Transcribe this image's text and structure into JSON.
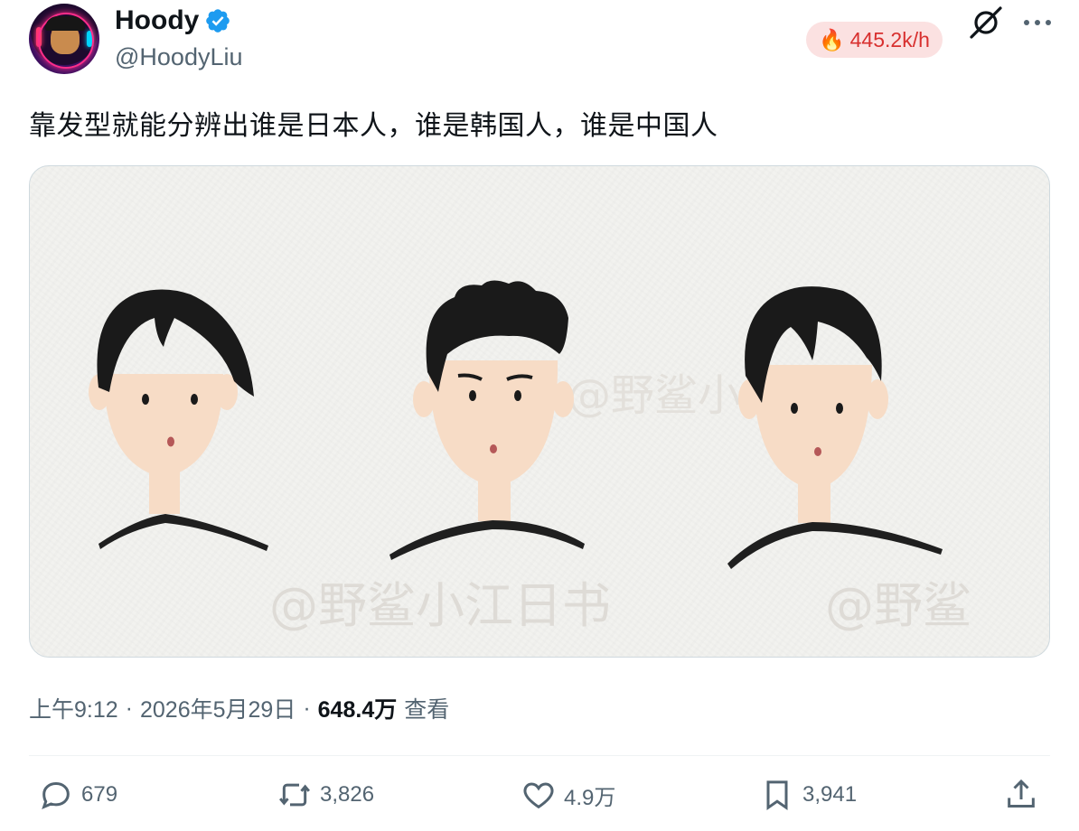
{
  "author": {
    "display_name": "Hoody",
    "handle": "@HoodyLiu"
  },
  "trend_badge": {
    "emoji": "🔥",
    "text": "445.2k/h"
  },
  "tweet": {
    "text": "靠发型就能分辨出谁是日本人，谁是韩国人，谁是中国人"
  },
  "media": {
    "icon": "illustration-image",
    "watermarks": [
      "@野鲨小江日书",
      "@野鲨小江日书",
      "@野鲨"
    ]
  },
  "meta": {
    "time": "上午9:12",
    "sep1": "·",
    "date": "2026年5月29日",
    "sep2": "·",
    "views": "648.4万",
    "views_label": "查看"
  },
  "actions": {
    "reply_count": "679",
    "retweet_count": "3,826",
    "like_count": "4.9万",
    "bookmark_count": "3,941"
  },
  "colors": {
    "verified": "#1d9bf0",
    "text_primary": "#0f1419",
    "text_secondary": "#536471",
    "badge_bg": "#fbe1e1",
    "badge_text": "#d8302f"
  }
}
